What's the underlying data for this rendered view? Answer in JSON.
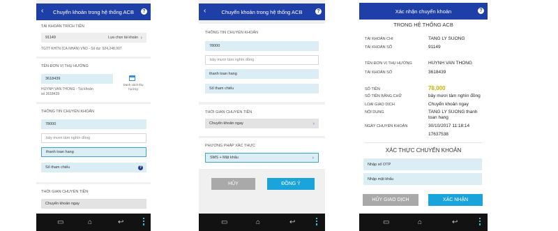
{
  "screen1": {
    "title": "Chuyển khoản trong hệ thống ACB",
    "debit_label": "TÀI KHOẢN TRÍCH TIỀN",
    "account": "91149",
    "select_account": "Lựa chọn tài khoản",
    "account_info": "TGTT KHTN (CA NHAN) VND - Số dư: 924,248,907",
    "beneficiary_label": "TÊN ĐƠN VỊ THỤ HƯỞNG",
    "beneficiary_account": "3618439",
    "contact_list": "Danh sách thụ hưởng",
    "beneficiary_info": "HUYNH VAN THONG - Tài khoản số 3618439",
    "transfer_info_label": "THÔNG TIN CHUYỂN KHOẢN",
    "amount": "78000",
    "amount_words": "bảy mươi tám nghìn đồng",
    "content": "thanh toan hang",
    "ref_placeholder": "Số tham chiếu",
    "time_label": "THỜI GIAN CHUYỂN TIỀN",
    "time_value": "Chuyển khoản ngay"
  },
  "screen2": {
    "title": "Chuyển khoản trong hệ thống ACB",
    "transfer_info_label": "THÔNG TIN CHUYỂN KHOẢN",
    "amount": "78000",
    "amount_words": "bảy mươi tám nghìn đồng",
    "content": "thanh toan hang",
    "ref_placeholder": "Số tham chiếu",
    "time_label": "THỜI GIAN CHUYỂN TIỀN",
    "time_value": "Chuyển khoản ngay",
    "auth_label": "PHƯƠNG PHÁP XÁC THỰC",
    "auth_value": "SMS + Mật khẩu",
    "cancel": "HỦY",
    "confirm": "ĐỒNG Ý"
  },
  "screen3": {
    "title": "Xác nhận chuyển khoản",
    "section_title": "TRONG HỆ THỐNG ACB",
    "debit_account_label": "TÀI KHOẢN CHI",
    "debit_account_name": "TANG LY SUONG",
    "account_no_label": "TÀI KHOẢN SỐ",
    "account_no": "91149",
    "beneficiary_label": "TÊN ĐƠN VỊ THỤ HƯỞNG",
    "beneficiary_name": "HUYNH VAN THONG",
    "beneficiary_acc_label": "TÀI KHOẢN SỐ",
    "beneficiary_acc": "3618439",
    "amount_label": "SỐ TIỀN",
    "amount": "78,000",
    "amount_words_label": "SỐ TIỀN BẰNG CHỮ",
    "amount_words": "bảy mươi tám nghìn đồng",
    "type_label": "LOẠI GIAO DỊCH",
    "type_value": "Chuyển khoản ngay",
    "content_label": "NỘI DUNG",
    "content_value": "TANG LY SUONG thanh toan hang",
    "date_label": "NGÀY CHUYỂN KHOẢN",
    "date_value": "30/10/2017 11:18:14",
    "ref_value": "17637538",
    "auth_title": "XÁC THỰC CHUYỂN KHOẢN",
    "otp_placeholder": "Nhập số OTP",
    "password_placeholder": "Nhập mật khẩu",
    "cancel": "HỦY GIAO DỊCH",
    "confirm": "XÁC NHẬN"
  },
  "colors": {
    "header": "#1f3fa8",
    "field": "#dbeef6",
    "confirm_button": "#1ba3dc",
    "cancel_button": "#a9a9a9",
    "amount_highlight": "#c7b300"
  },
  "icons": [
    "back-arrow-icon",
    "help-icon",
    "chevron-right-icon",
    "calendar-icon",
    "recent-apps-icon",
    "home-icon",
    "back-icon",
    "menu-icon"
  ]
}
